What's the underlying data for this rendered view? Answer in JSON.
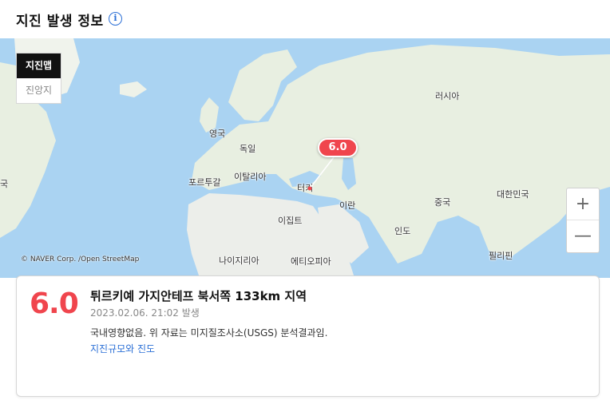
{
  "header": {
    "title": "지진 발생 정보",
    "info_icon": "info-icon",
    "info_glyph": "i"
  },
  "map": {
    "toggle": [
      {
        "label": "지진맵",
        "active": true
      },
      {
        "label": "진앙지",
        "active": false
      }
    ],
    "countries": {
      "russia": "러시아",
      "uk": "영국",
      "germany": "독일",
      "portugal": "포르투갈",
      "italy": "이탈리아",
      "turkey": "터키",
      "egypt": "이집트",
      "iran": "이란",
      "china": "중국",
      "korea": "대한민국",
      "india": "인도",
      "philippines": "필리핀",
      "nigeria": "나이지리아",
      "ethiopia": "에티오피아",
      "edge_left": "국"
    },
    "marker_value": "6.0",
    "zoom_in": "+",
    "zoom_out": "—",
    "attribution": "© NAVER Corp. /Open StreetMap"
  },
  "quake": {
    "magnitude": "6.0",
    "location": "튀르키예 가지안테프 북서쪽 133km 지역",
    "time": "2023.02.06. 21:02 발생",
    "description": "국내영향없음. 위 자료는 미지질조사소(USGS) 분석결과임.",
    "link": "지진규모와 진도"
  },
  "colors": {
    "accent": "#f0454d",
    "link": "#2b6fd6",
    "sea": "#aad3f2",
    "land": "#e8efe1"
  }
}
